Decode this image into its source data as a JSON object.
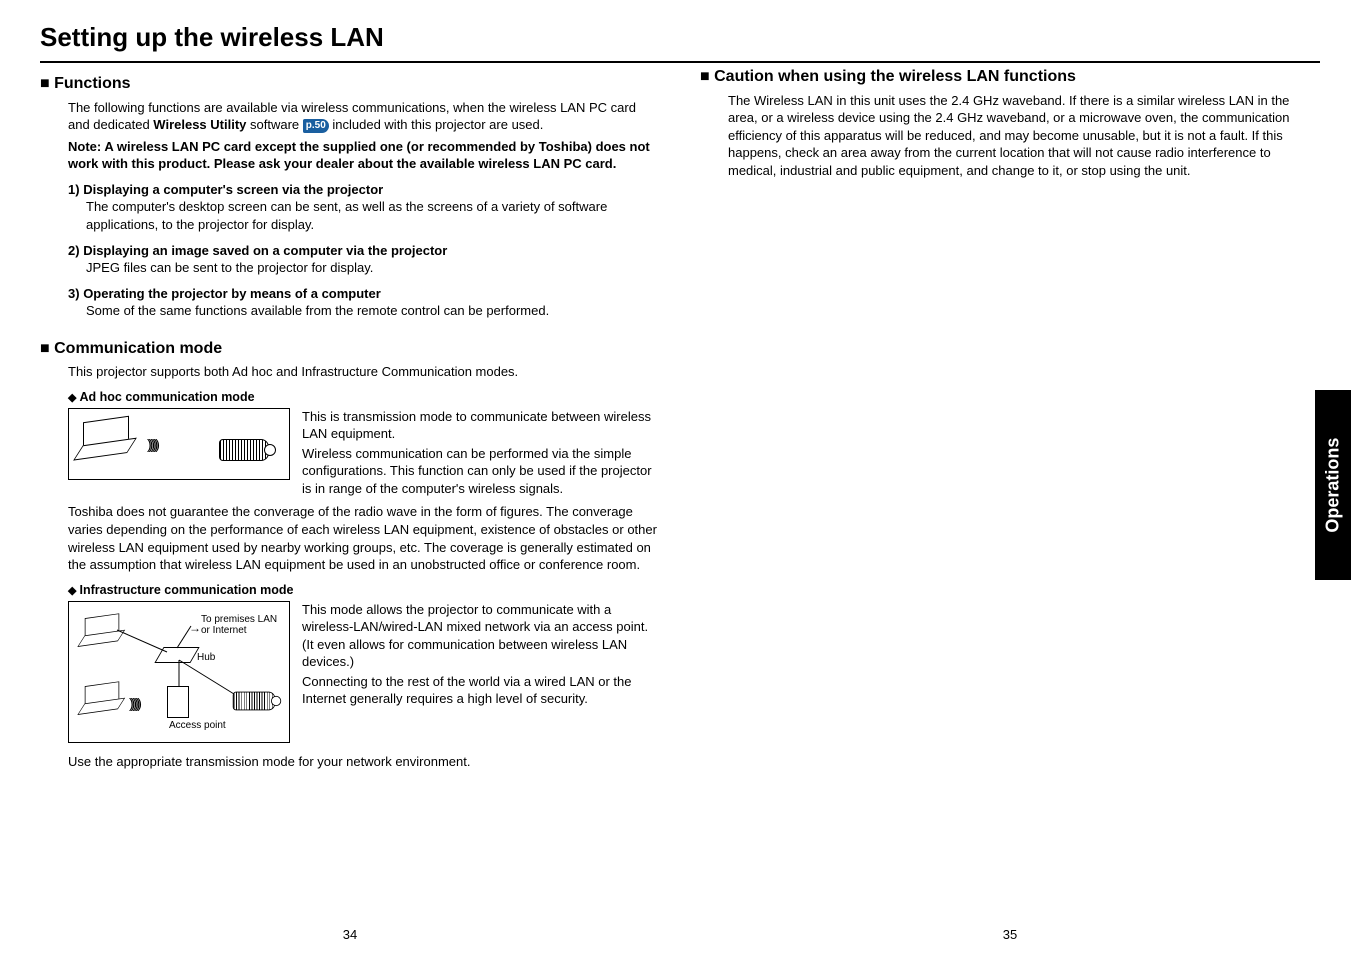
{
  "title": "Setting up the wireless LAN",
  "left": {
    "sections": {
      "functions": {
        "heading": "Functions",
        "intro_pre": "The following functions are available via wireless communications, when the wireless LAN PC card and dedicated ",
        "intro_bold1": "Wireless Utility",
        "intro_mid": " software ",
        "page_ref": "p.50",
        "intro_post": " included with this projector are used.",
        "note": "Note: A wireless LAN PC card except the supplied one (or recommended by Toshiba) does not work with this product.  Please ask your dealer about the available wireless LAN PC card.",
        "items": [
          {
            "num": "1)",
            "title": "Displaying a computer's screen via the projector",
            "body": "The computer's desktop screen can be sent, as well as the screens of a variety of software applications, to the projector for display."
          },
          {
            "num": "2)",
            "title": "Displaying an image saved on a computer via the projector",
            "body": "JPEG files can be sent to the projector for display."
          },
          {
            "num": "3)",
            "title": "Operating the projector by means of a computer",
            "body": "Some of the same functions available from the remote control can be performed."
          }
        ]
      },
      "comm": {
        "heading": "Communication mode",
        "intro": "This projector supports both Ad hoc and Infrastructure Communication modes.",
        "adhoc": {
          "label": "Ad hoc communication mode",
          "para1": "This is transmission mode to communicate between wireless LAN equipment.",
          "para2": "Wireless communication can be performed via the simple configurations. This function can only be used if the projector is in range of the computer's wireless signals.",
          "below": "Toshiba does not guarantee the converage of the radio wave in the form of figures. The converage varies depending on the performance of each wireless LAN equipment, existence of obstacles or other wireless LAN equipment used by nearby working groups, etc. The coverage is generally estimated on the assumption that wireless LAN equipment be used in an unobstructed office or conference room."
        },
        "infra": {
          "label": "Infrastructure communication mode",
          "para1": "This mode allows the projector to communicate with a wireless-LAN/wired-LAN mixed network via an access point. (It even allows for communication between wireless LAN devices.)",
          "para2": "Connecting to the rest of the world via a wired LAN or the Internet generally requires a high level of security.",
          "fig": {
            "to_premises": "To premises LAN or Internet",
            "hub": "Hub",
            "access_point": "Access point"
          }
        },
        "closing": "Use the appropriate transmission mode for your network environment."
      }
    },
    "page_num": "34"
  },
  "right": {
    "caution": {
      "heading": "Caution when using the wireless LAN functions",
      "body": "The Wireless LAN in this unit uses the 2.4 GHz waveband.  If there is a similar wireless LAN in the area, or a wireless device using the 2.4 GHz waveband, or a microwave oven, the communication efficiency of this apparatus will be reduced, and may become unusable, but it is not a fault. If this happens, check an area away from the current location that will not cause radio interference to medical, industrial and public equipment, and change to it, or stop using the unit."
    },
    "page_num": "35"
  },
  "side_tab": "Operations"
}
